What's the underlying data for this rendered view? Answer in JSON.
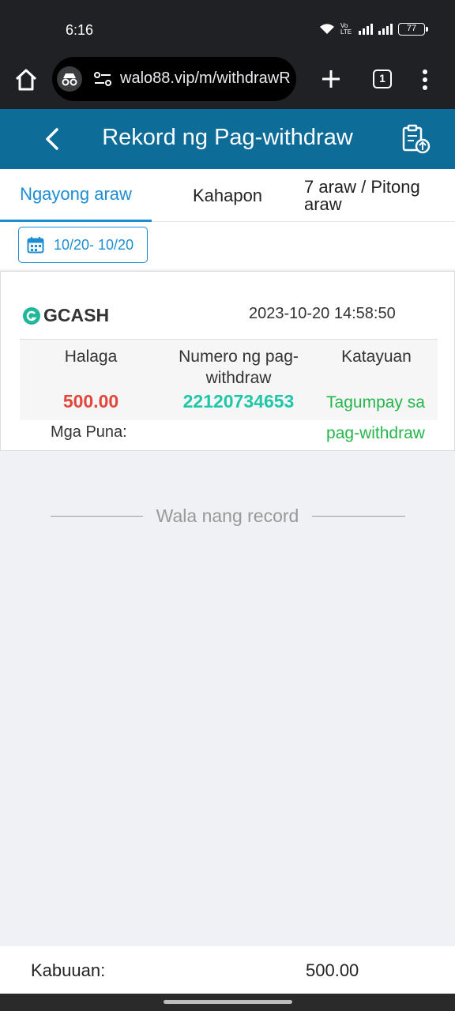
{
  "status_bar": {
    "time": "6:16",
    "volte": "Vo LTE",
    "battery": "77"
  },
  "browser": {
    "url": "walo88.vip/m/withdrawR",
    "tab_count": "1"
  },
  "header": {
    "title": "Rekord ng Pag-withdraw"
  },
  "tabs": [
    {
      "label": "Ngayong araw",
      "active": true
    },
    {
      "label": "Kahapon",
      "active": false
    },
    {
      "label": "7 araw / Pitong araw",
      "active": false
    }
  ],
  "date_filter": {
    "range": "10/20- 10/20"
  },
  "records": [
    {
      "method": "GCASH",
      "datetime": "2023-10-20 14:58:50",
      "amount_label": "Halaga",
      "number_label": "Numero ng pag-withdraw",
      "status_label": "Katayuan",
      "amount": "500.00",
      "number": "22120734653",
      "status": "Tagumpay sa pag-withdraw",
      "remarks_label": "Mga Puna:"
    }
  ],
  "no_more_text": "Wala nang record",
  "footer": {
    "total_label": "Kabuuan:",
    "total_value": "500.00"
  },
  "colors": {
    "header_bg": "#0d6c98",
    "accent": "#1d8dd3",
    "amount": "#e2463b",
    "number": "#1fc7a6",
    "success": "#24b64b"
  }
}
